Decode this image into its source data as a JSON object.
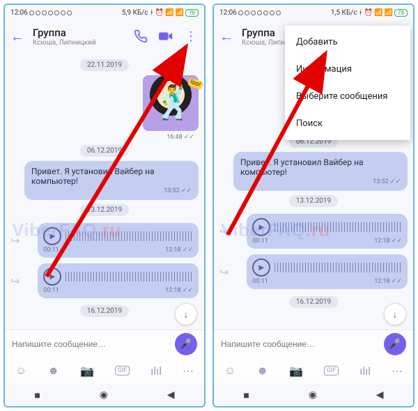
{
  "status": {
    "time": "12:06",
    "net_left": "5,9 КБ/с",
    "net_right": "1,5 КБ/с"
  },
  "header": {
    "title": "Группа",
    "subtitle": "Ксюша, Липницкий"
  },
  "chat": {
    "date1": "22.11.2019",
    "sticker_time": "16:48",
    "date2": "06.12.2019",
    "msg1": "Привет. Я установил Вайбер на компьютер!",
    "msg1_time": "13:52",
    "date3": "13.12.2019",
    "voice1_dur": "00:11",
    "voice1_time": "12:18",
    "voice2_dur": "00:11",
    "voice2_time": "12:18",
    "date4": "16.12.2019"
  },
  "input": {
    "placeholder": "Напишите сообщение…"
  },
  "menu": {
    "add": "Добавить",
    "info": "Информация",
    "select": "Выберите сообщения",
    "search": "Поиск"
  },
  "watermark": {
    "a": "ViberFAQ.",
    "b": "ru"
  },
  "tools": {
    "gif": "GIF"
  },
  "ticks": "✓✓"
}
